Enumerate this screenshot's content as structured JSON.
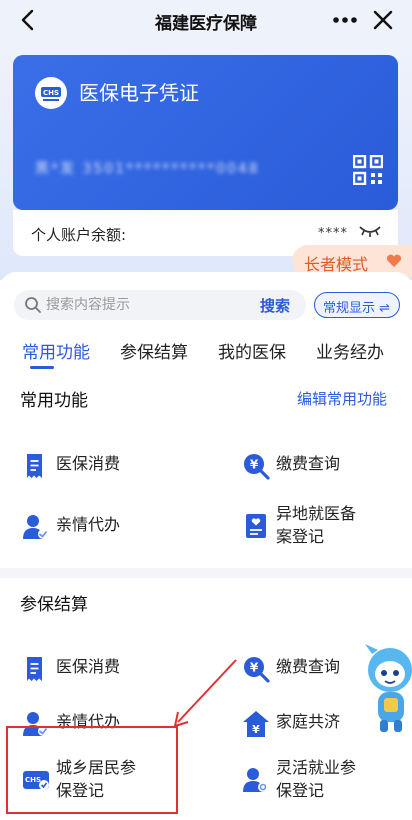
{
  "topbar": {
    "title": "福建医疗保障",
    "back_icon": "chevron-left-icon",
    "more_icon": "more-dots-icon",
    "close_icon": "close-icon"
  },
  "card": {
    "title": "医保电子凭证",
    "logo_text": "CHS",
    "id_masked": "黑*发 3501**********0048",
    "qr_icon": "qr-code-icon"
  },
  "balance": {
    "label": "个人账户余额:",
    "value": "****"
  },
  "elder_mode": {
    "label": "长者模式"
  },
  "search": {
    "placeholder": "搜索内容提示",
    "button_label": "搜索",
    "mode_label": "常规显示 ⇌"
  },
  "tabs": [
    {
      "label": "常用功能",
      "active": true
    },
    {
      "label": "参保结算",
      "active": false
    },
    {
      "label": "我的医保",
      "active": false
    },
    {
      "label": "业务经办",
      "active": false
    }
  ],
  "common": {
    "title": "常用功能",
    "edit_label": "编辑常用功能",
    "items": [
      {
        "label": "医保消费",
        "icon": "receipt-icon"
      },
      {
        "label": "缴费查询",
        "icon": "yuan-search-icon"
      },
      {
        "label": "亲情代办",
        "icon": "user-proxy-icon"
      },
      {
        "label": "异地就医备案登记",
        "line1": "异地就医备",
        "line2": "案登记",
        "icon": "heart-doc-icon"
      }
    ]
  },
  "insurance": {
    "title": "参保结算",
    "items": [
      {
        "label": "医保消费",
        "icon": "receipt-icon"
      },
      {
        "label": "缴费查询",
        "icon": "yuan-search-icon"
      },
      {
        "label": "亲情代办",
        "icon": "user-proxy-icon"
      },
      {
        "label": "家庭共济",
        "icon": "family-yuan-icon"
      },
      {
        "label": "城乡居民参保登记",
        "line1": "城乡居民参",
        "line2": "保登记",
        "icon": "chs-card-icon"
      },
      {
        "label": "灵活就业参保登记",
        "line1": "灵活就业参",
        "line2": "保登记",
        "icon": "user-settings-icon"
      }
    ]
  },
  "colors": {
    "primary": "#2a5bd9",
    "accent_orange": "#e05a2b",
    "highlight_red": "#e03030"
  }
}
